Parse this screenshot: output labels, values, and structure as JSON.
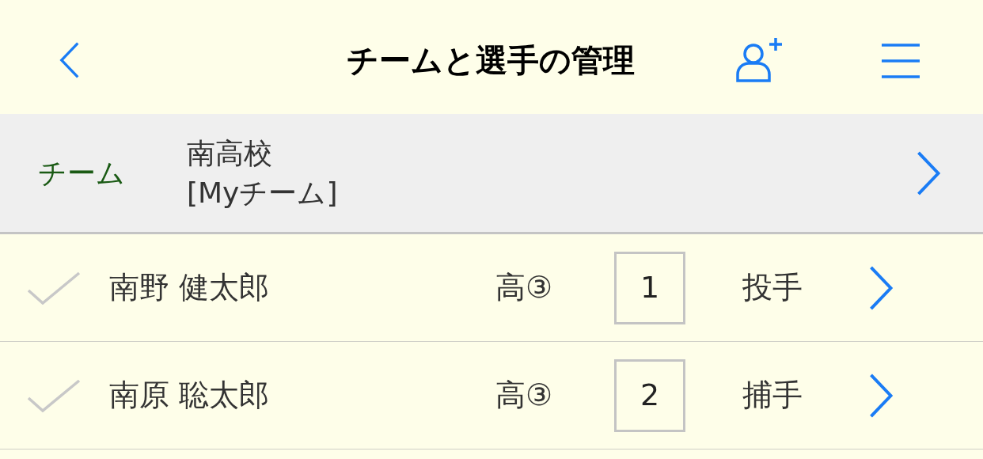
{
  "header": {
    "title": "チームと選手の管理"
  },
  "team": {
    "label": "チーム",
    "name": "南高校",
    "tag": "[Myチーム]"
  },
  "players": [
    {
      "name": "南野 健太郎",
      "grade": "高③",
      "number": "1",
      "position": "投手",
      "checked": false
    },
    {
      "name": "南原 聡太郎",
      "grade": "高③",
      "number": "2",
      "position": "捕手",
      "checked": false
    }
  ]
}
